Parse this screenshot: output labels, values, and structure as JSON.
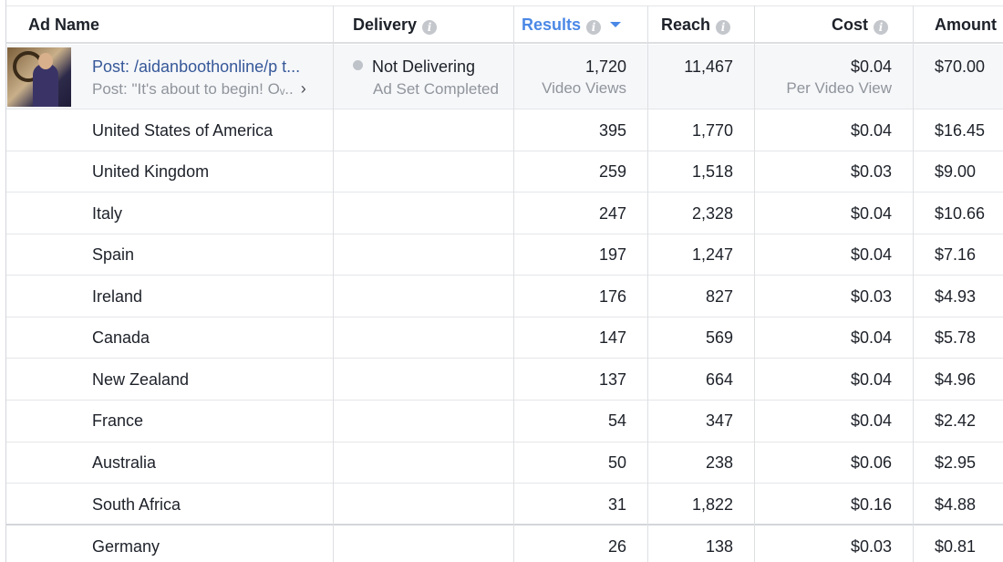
{
  "header": {
    "ad_name": "Ad Name",
    "delivery": "Delivery",
    "results": "Results",
    "reach": "Reach",
    "cost": "Cost",
    "amount": "Amount"
  },
  "campaign": {
    "post_title": "Post: /aidanboothonline/p t...",
    "post_subtitle": "Post: \"It's about to begin! Oᵥ..",
    "delivery_status": "Not Delivering",
    "delivery_sub": "Ad Set Completed",
    "results": "1,720",
    "results_sub": "Video Views",
    "reach": "11,467",
    "cost": "$0.04",
    "cost_sub": "Per Video View",
    "amount": "$70.00"
  },
  "rows": [
    {
      "country": "United States of America",
      "results": "395",
      "reach": "1,770",
      "cost": "$0.04",
      "amount": "$16.45"
    },
    {
      "country": "United Kingdom",
      "results": "259",
      "reach": "1,518",
      "cost": "$0.03",
      "amount": "$9.00"
    },
    {
      "country": "Italy",
      "results": "247",
      "reach": "2,328",
      "cost": "$0.04",
      "amount": "$10.66"
    },
    {
      "country": "Spain",
      "results": "197",
      "reach": "1,247",
      "cost": "$0.04",
      "amount": "$7.16"
    },
    {
      "country": "Ireland",
      "results": "176",
      "reach": "827",
      "cost": "$0.03",
      "amount": "$4.93"
    },
    {
      "country": "Canada",
      "results": "147",
      "reach": "569",
      "cost": "$0.04",
      "amount": "$5.78"
    },
    {
      "country": "New Zealand",
      "results": "137",
      "reach": "664",
      "cost": "$0.04",
      "amount": "$4.96"
    },
    {
      "country": "France",
      "results": "54",
      "reach": "347",
      "cost": "$0.04",
      "amount": "$2.42"
    },
    {
      "country": "Australia",
      "results": "50",
      "reach": "238",
      "cost": "$0.06",
      "amount": "$2.95"
    },
    {
      "country": "South Africa",
      "results": "31",
      "reach": "1,822",
      "cost": "$0.16",
      "amount": "$4.88"
    },
    {
      "country": "Germany",
      "results": "26",
      "reach": "138",
      "cost": "$0.03",
      "amount": "$0.81"
    }
  ],
  "colors": {
    "accent": "#4b88e6",
    "link": "#365899",
    "muted": "#90949c"
  },
  "icons": {
    "info": "info-circle-icon",
    "sort": "sort-descending-icon",
    "status": "status-dot-icon",
    "expand": "chevron-right-icon"
  }
}
